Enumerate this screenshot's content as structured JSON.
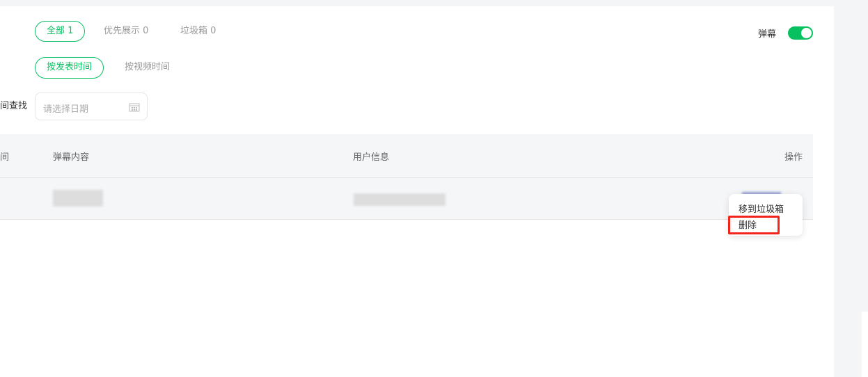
{
  "filters": {
    "tabs": [
      {
        "label": "全部 1",
        "active": true
      },
      {
        "label": "优先展示 0"
      },
      {
        "label": "垃圾箱 0"
      }
    ],
    "sort": [
      {
        "label": "按发表时间",
        "active": true
      },
      {
        "label": "按视频时间"
      }
    ],
    "date_label": "间查找",
    "date_placeholder": "请选择日期"
  },
  "danmu": {
    "label": "弹幕",
    "enabled": true
  },
  "table": {
    "headers": [
      "间",
      "弹幕内容",
      "用户信息",
      "操作"
    ]
  },
  "menu": {
    "items": [
      "移到垃圾箱",
      "删除"
    ],
    "highlighted": "删除"
  },
  "colors": {
    "accent": "#07c160",
    "highlight": "#f5241b"
  }
}
